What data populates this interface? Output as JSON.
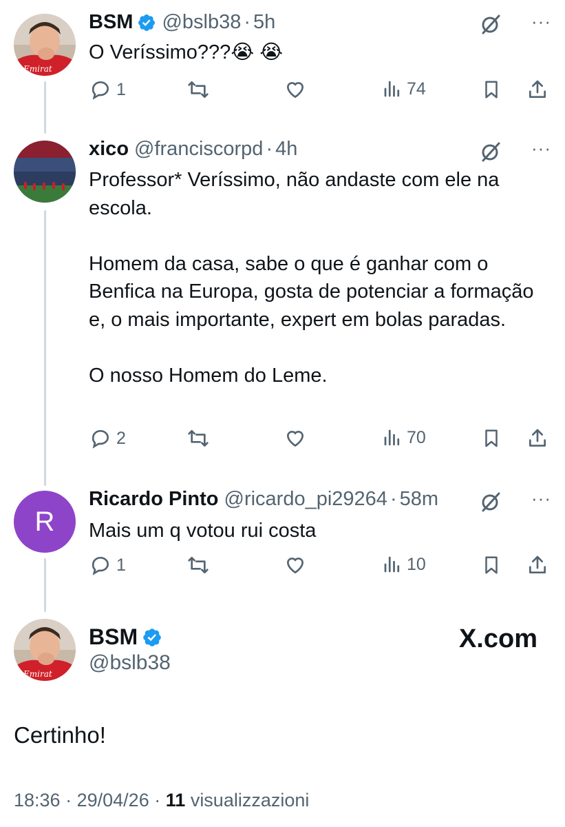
{
  "tweets": [
    {
      "name": "BSM",
      "handle": "@bslb38",
      "time": "5h",
      "text": "O Veríssimo???😭 😭",
      "replies": "1",
      "views": "74",
      "avatar": "player-photo"
    },
    {
      "name": "xico",
      "handle": "@franciscorpd",
      "time": "4h",
      "text": "Professor* Veríssimo, não andaste com ele na escola.\n\nHomem da casa, sabe o que é ganhar com o Benfica na Europa, gosta de potenciar a formação e, o mais importante, expert em bolas paradas.\n\nO nosso Homem do Leme.",
      "replies": "2",
      "views": "70",
      "avatar": "stadium-photo"
    },
    {
      "name": "Ricardo Pinto",
      "handle": "@ricardo_pi29264",
      "time": "58m",
      "text": "Mais um q votou rui costa",
      "replies": "1",
      "views": "10",
      "avatar": "R",
      "avatar_color": "#8e44c9"
    }
  ],
  "main": {
    "name": "BSM",
    "handle": "@bslb38",
    "text": "Certinho!",
    "time": "18:36",
    "date": "29/04/26",
    "views_count": "11",
    "views_label": "visualizzazioni",
    "watermark": "X.com"
  },
  "separator": "·",
  "colors": {
    "verified": "#1d9bf0",
    "secondary": "#536471",
    "thread_line": "#cfd9de"
  },
  "icons": [
    "verified-badge-icon",
    "grok-icon",
    "more-icon",
    "reply-icon",
    "repost-icon",
    "like-icon",
    "views-icon",
    "bookmark-icon",
    "share-icon"
  ]
}
